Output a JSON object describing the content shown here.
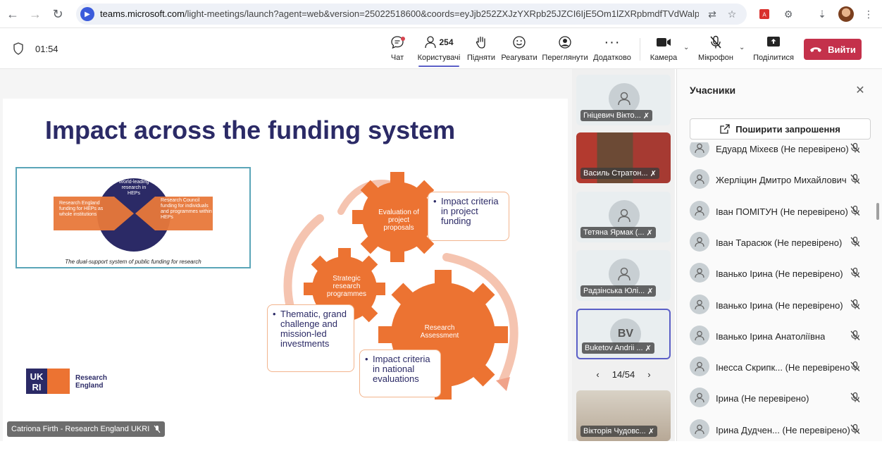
{
  "browser": {
    "url_host": "teams.microsoft.com",
    "url_rest": "/light-meetings/launch?agent=web&version=25022518600&coords=eyJjb252ZXJzYXRpb25JZCI6IjE5Om1lZXRpbmdfTVdWalpE..."
  },
  "toolbar": {
    "timer": "01:54",
    "chat": "Чат",
    "participants_count": "254",
    "participants": "Користувачі",
    "raise": "Підняти",
    "react": "Реагувати",
    "view": "Переглянути",
    "more": "Додатково",
    "camera": "Камера",
    "mic": "Мікрофон",
    "share": "Поділитися",
    "leave": "Вийти"
  },
  "slide": {
    "title": "Impact across the funding system",
    "dual_left": "Research England funding for HEPs as whole institutions",
    "dual_center": "World-leading research in HEPs",
    "dual_right": "Research Council funding for individuals and programmes within HEPs",
    "dual_caption": "The dual-support system of public funding for research",
    "gear_eval": "Evaluation of project proposals",
    "gear_strategic": "Strategic research programmes",
    "gear_assessment": "Research Assessment",
    "callout_project": "Impact criteria in project funding",
    "callout_thematic": "Thematic, grand challenge and mission-led investments",
    "callout_national": "Impact criteria in national evaluations",
    "logo_text_1": "Research",
    "logo_text_2": "England",
    "speaker": "Catriona Firth - Research England UKRI"
  },
  "tiles": [
    {
      "name": "Гніцевич Вікто..."
    },
    {
      "name": "Василь Стратон..."
    },
    {
      "name": "Тетяна Ярмак (..."
    },
    {
      "name": "Радзінська Юлі..."
    },
    {
      "name": "Buketov Andrii ...",
      "initials": "BV"
    },
    {
      "name": "Вікторія Чудовс..."
    }
  ],
  "pager": "14/54",
  "panel": {
    "title": "Учасники",
    "invite": "Поширити запрошення",
    "people": [
      "Едуард Міхеєв (Не перевірено)",
      "Жерліцин Дмитро Михайлович",
      "Іван ПОМІТУН (Не перевірено)",
      "Іван Тарасюк (Не перевірено)",
      "Іванько Ірина (Не перевірено)",
      "Іванько Ірина (Не перевірено)",
      "Іванько Ірина Анатоліївна",
      "Інесса Скрипк... (Не перевірено)",
      "Ірина (Не перевірено)",
      "Ірина Дудчен... (Не перевірено)"
    ]
  }
}
